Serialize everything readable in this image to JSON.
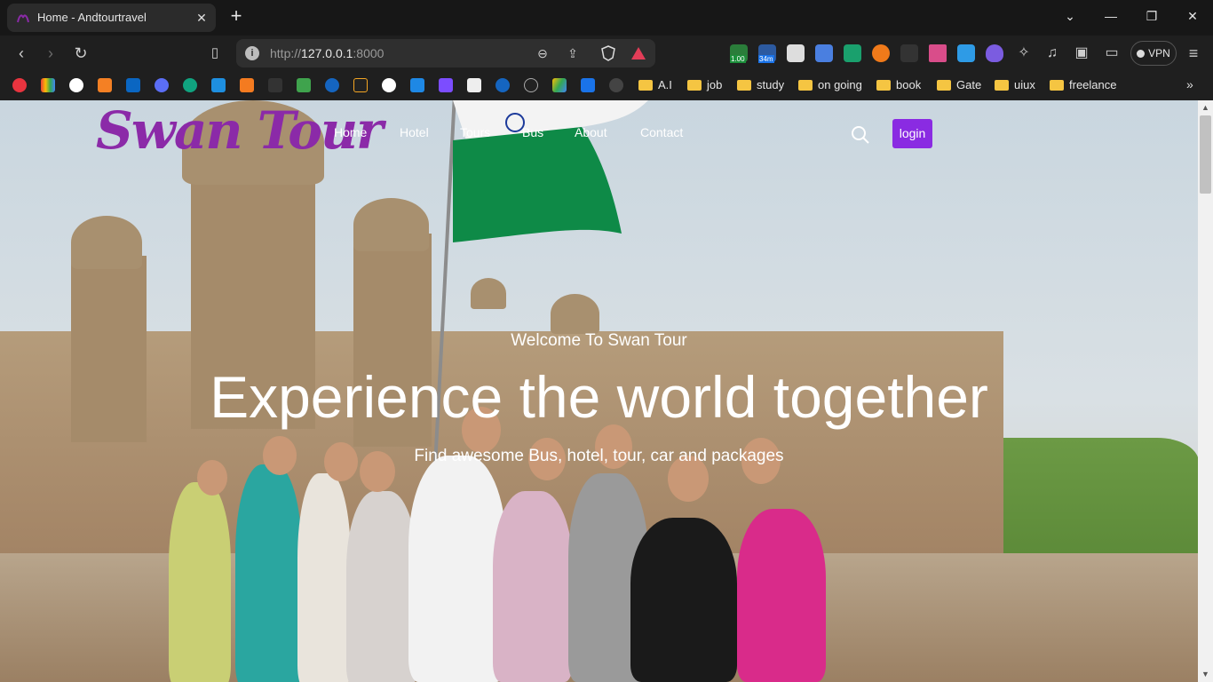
{
  "browser": {
    "tab_title": "Home - Andtourtravel",
    "tab_close": "✕",
    "new_tab": "+",
    "url_prefix": "http://",
    "url_host": "127.0.0.1",
    "url_port": ":8000",
    "vpn_label": "VPN",
    "ext_badges": [
      "1.00",
      "34m"
    ],
    "more_bookmarks": "»"
  },
  "bookmarks": {
    "folders": [
      "A.I",
      "job",
      "study",
      "on going",
      "book",
      "Gate",
      "uiux",
      "freelance"
    ]
  },
  "site": {
    "logo": "Swan Tour",
    "nav": [
      "Home",
      "Hotel",
      "Tours",
      "Bus",
      "About",
      "Contact"
    ],
    "login": "login",
    "hero": {
      "welcome": "Welcome To Swan Tour",
      "title": "Experience the world together",
      "tagline": "Find awesome Bus, hotel, tour, car and packages"
    }
  },
  "colors": {
    "accent": "#8a2be2",
    "logo": "#8b2aa8",
    "folder": "#f5c542"
  }
}
